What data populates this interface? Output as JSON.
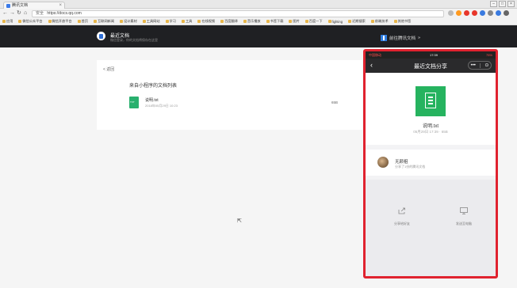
{
  "browser": {
    "tab_title": "腾讯文档",
    "url": "https://docs.qq.com",
    "secure_label": "安全",
    "bookmarks": [
      "应用",
      "微信公众平台",
      "微信开放平台",
      "首页",
      "互联网新闻",
      "设计素材",
      "工具网站",
      "学习",
      "工具",
      "在线视频",
      "百度翻译",
      "音乐播放",
      "书签下载",
      "图片",
      "百度一下",
      "fighting",
      "近期搜索",
      "前端技术",
      "其他书签"
    ]
  },
  "app": {
    "title": "最近文档",
    "subtitle": "微信登录，你的文档将保存在这里",
    "goto_label": "前往腾讯文档"
  },
  "main": {
    "back_label": "< 返回",
    "list_title": "来自小程序的文档列表",
    "files": [
      {
        "name": "说明.txt",
        "date": "2018年05月29日 10:23",
        "size": "65B"
      }
    ]
  },
  "phone": {
    "carrier": "中国移动",
    "time": "17:39",
    "battery": "75%",
    "nav_title": "最近文档分享",
    "capsule_more": "•••",
    "capsule_close": "⊙",
    "file_name": "说明.txt",
    "file_meta": "05月29日 17:39  ·  65B",
    "sharer_name": "无颜祖",
    "sharer_desc": "分享了1份的腾讯文档",
    "action_share": "分享给好友",
    "action_pc": "发送至电脑"
  },
  "colors": {
    "highlight": "#e0222f",
    "file_green": "#26b35f",
    "header_dark": "#1f2023"
  }
}
